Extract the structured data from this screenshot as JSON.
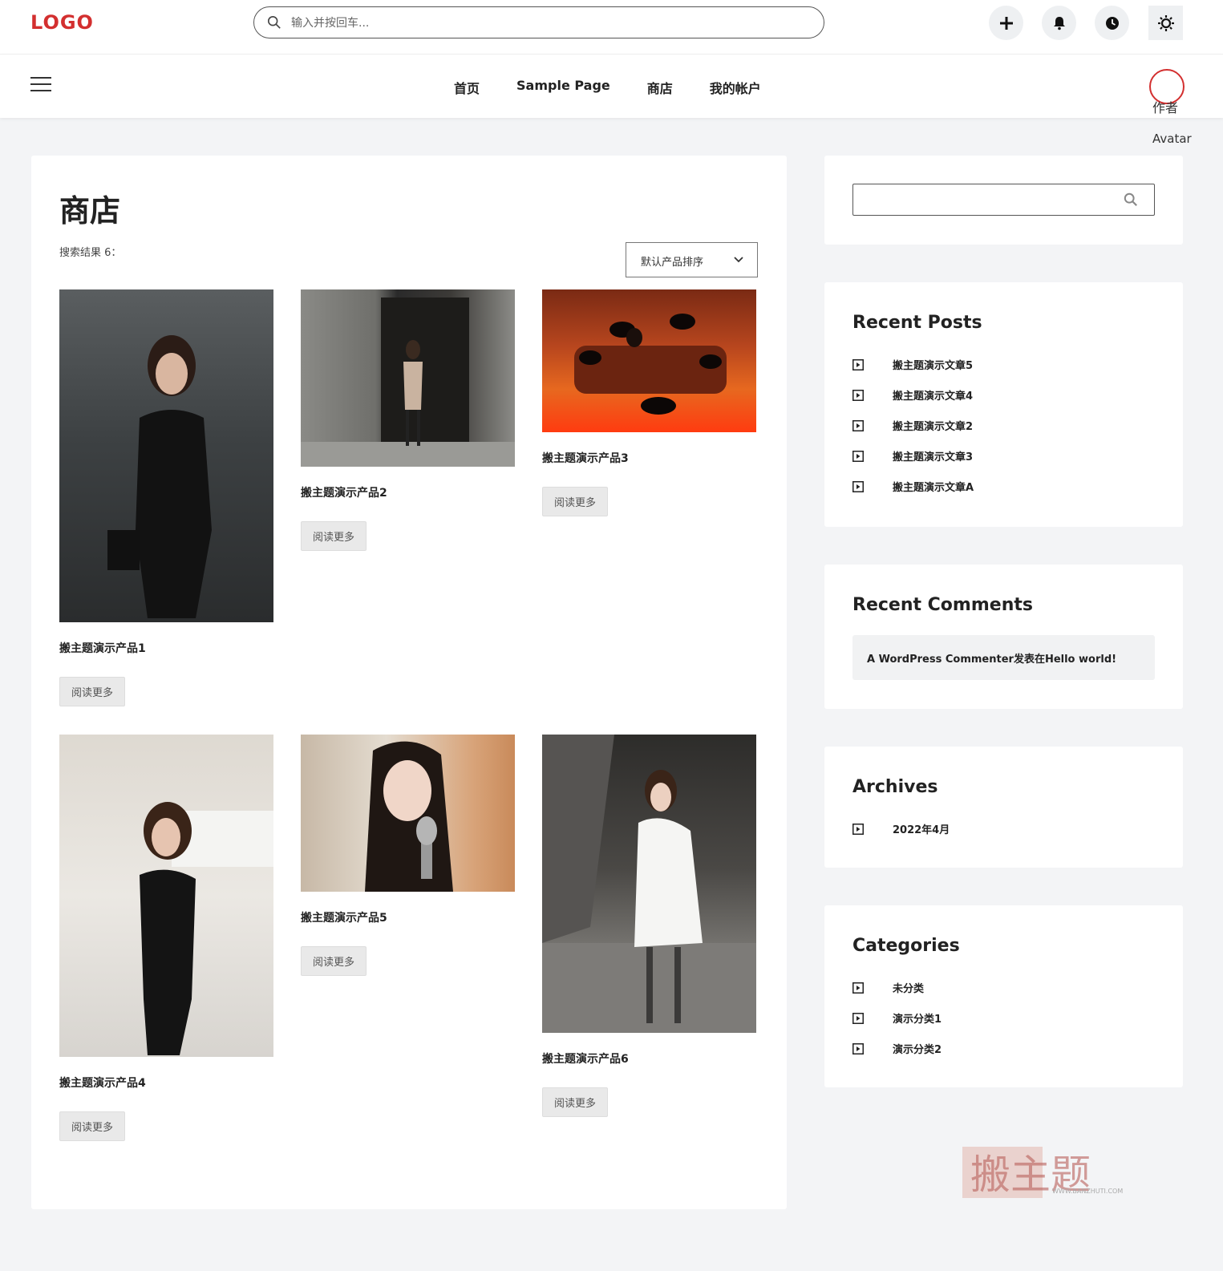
{
  "header": {
    "logo": "LOGO",
    "search_placeholder": "输入并按回车...",
    "icons": [
      "plus-icon",
      "bell-icon",
      "clock-icon",
      "sun-icon"
    ]
  },
  "nav": {
    "items": [
      "首页",
      "Sample Page",
      "商店",
      "我的帐户"
    ],
    "avatar_alt_line1": "作者",
    "avatar_alt_line2": "Avatar"
  },
  "main": {
    "title": "商店",
    "result_count": "搜索结果 6：",
    "sort_label": "默认产品排序",
    "read_more": "阅读更多",
    "products": [
      {
        "name": "搬主题演示产品1"
      },
      {
        "name": "搬主题演示产品2"
      },
      {
        "name": "搬主题演示产品3"
      },
      {
        "name": "搬主题演示产品4"
      },
      {
        "name": "搬主题演示产品5"
      },
      {
        "name": "搬主题演示产品6"
      }
    ]
  },
  "sidebar": {
    "recent_posts": {
      "title": "Recent Posts",
      "items": [
        "搬主题演示文章5",
        "搬主题演示文章4",
        "搬主题演示文章2",
        "搬主题演示文章3",
        "搬主题演示文章A"
      ]
    },
    "recent_comments": {
      "title": "Recent Comments",
      "text": "A WordPress Commenter发表在Hello world!"
    },
    "archives": {
      "title": "Archives",
      "items": [
        "2022年4月"
      ]
    },
    "categories": {
      "title": "Categories",
      "items": [
        "未分类",
        "演示分类1",
        "演示分类2"
      ]
    }
  },
  "watermark": {
    "text": "搬主题",
    "url": "WWW.BANZHUTI.COM"
  },
  "colors": {
    "brand": "#d32f2f",
    "background": "#f3f4f6",
    "button": "#e9e9e9"
  }
}
